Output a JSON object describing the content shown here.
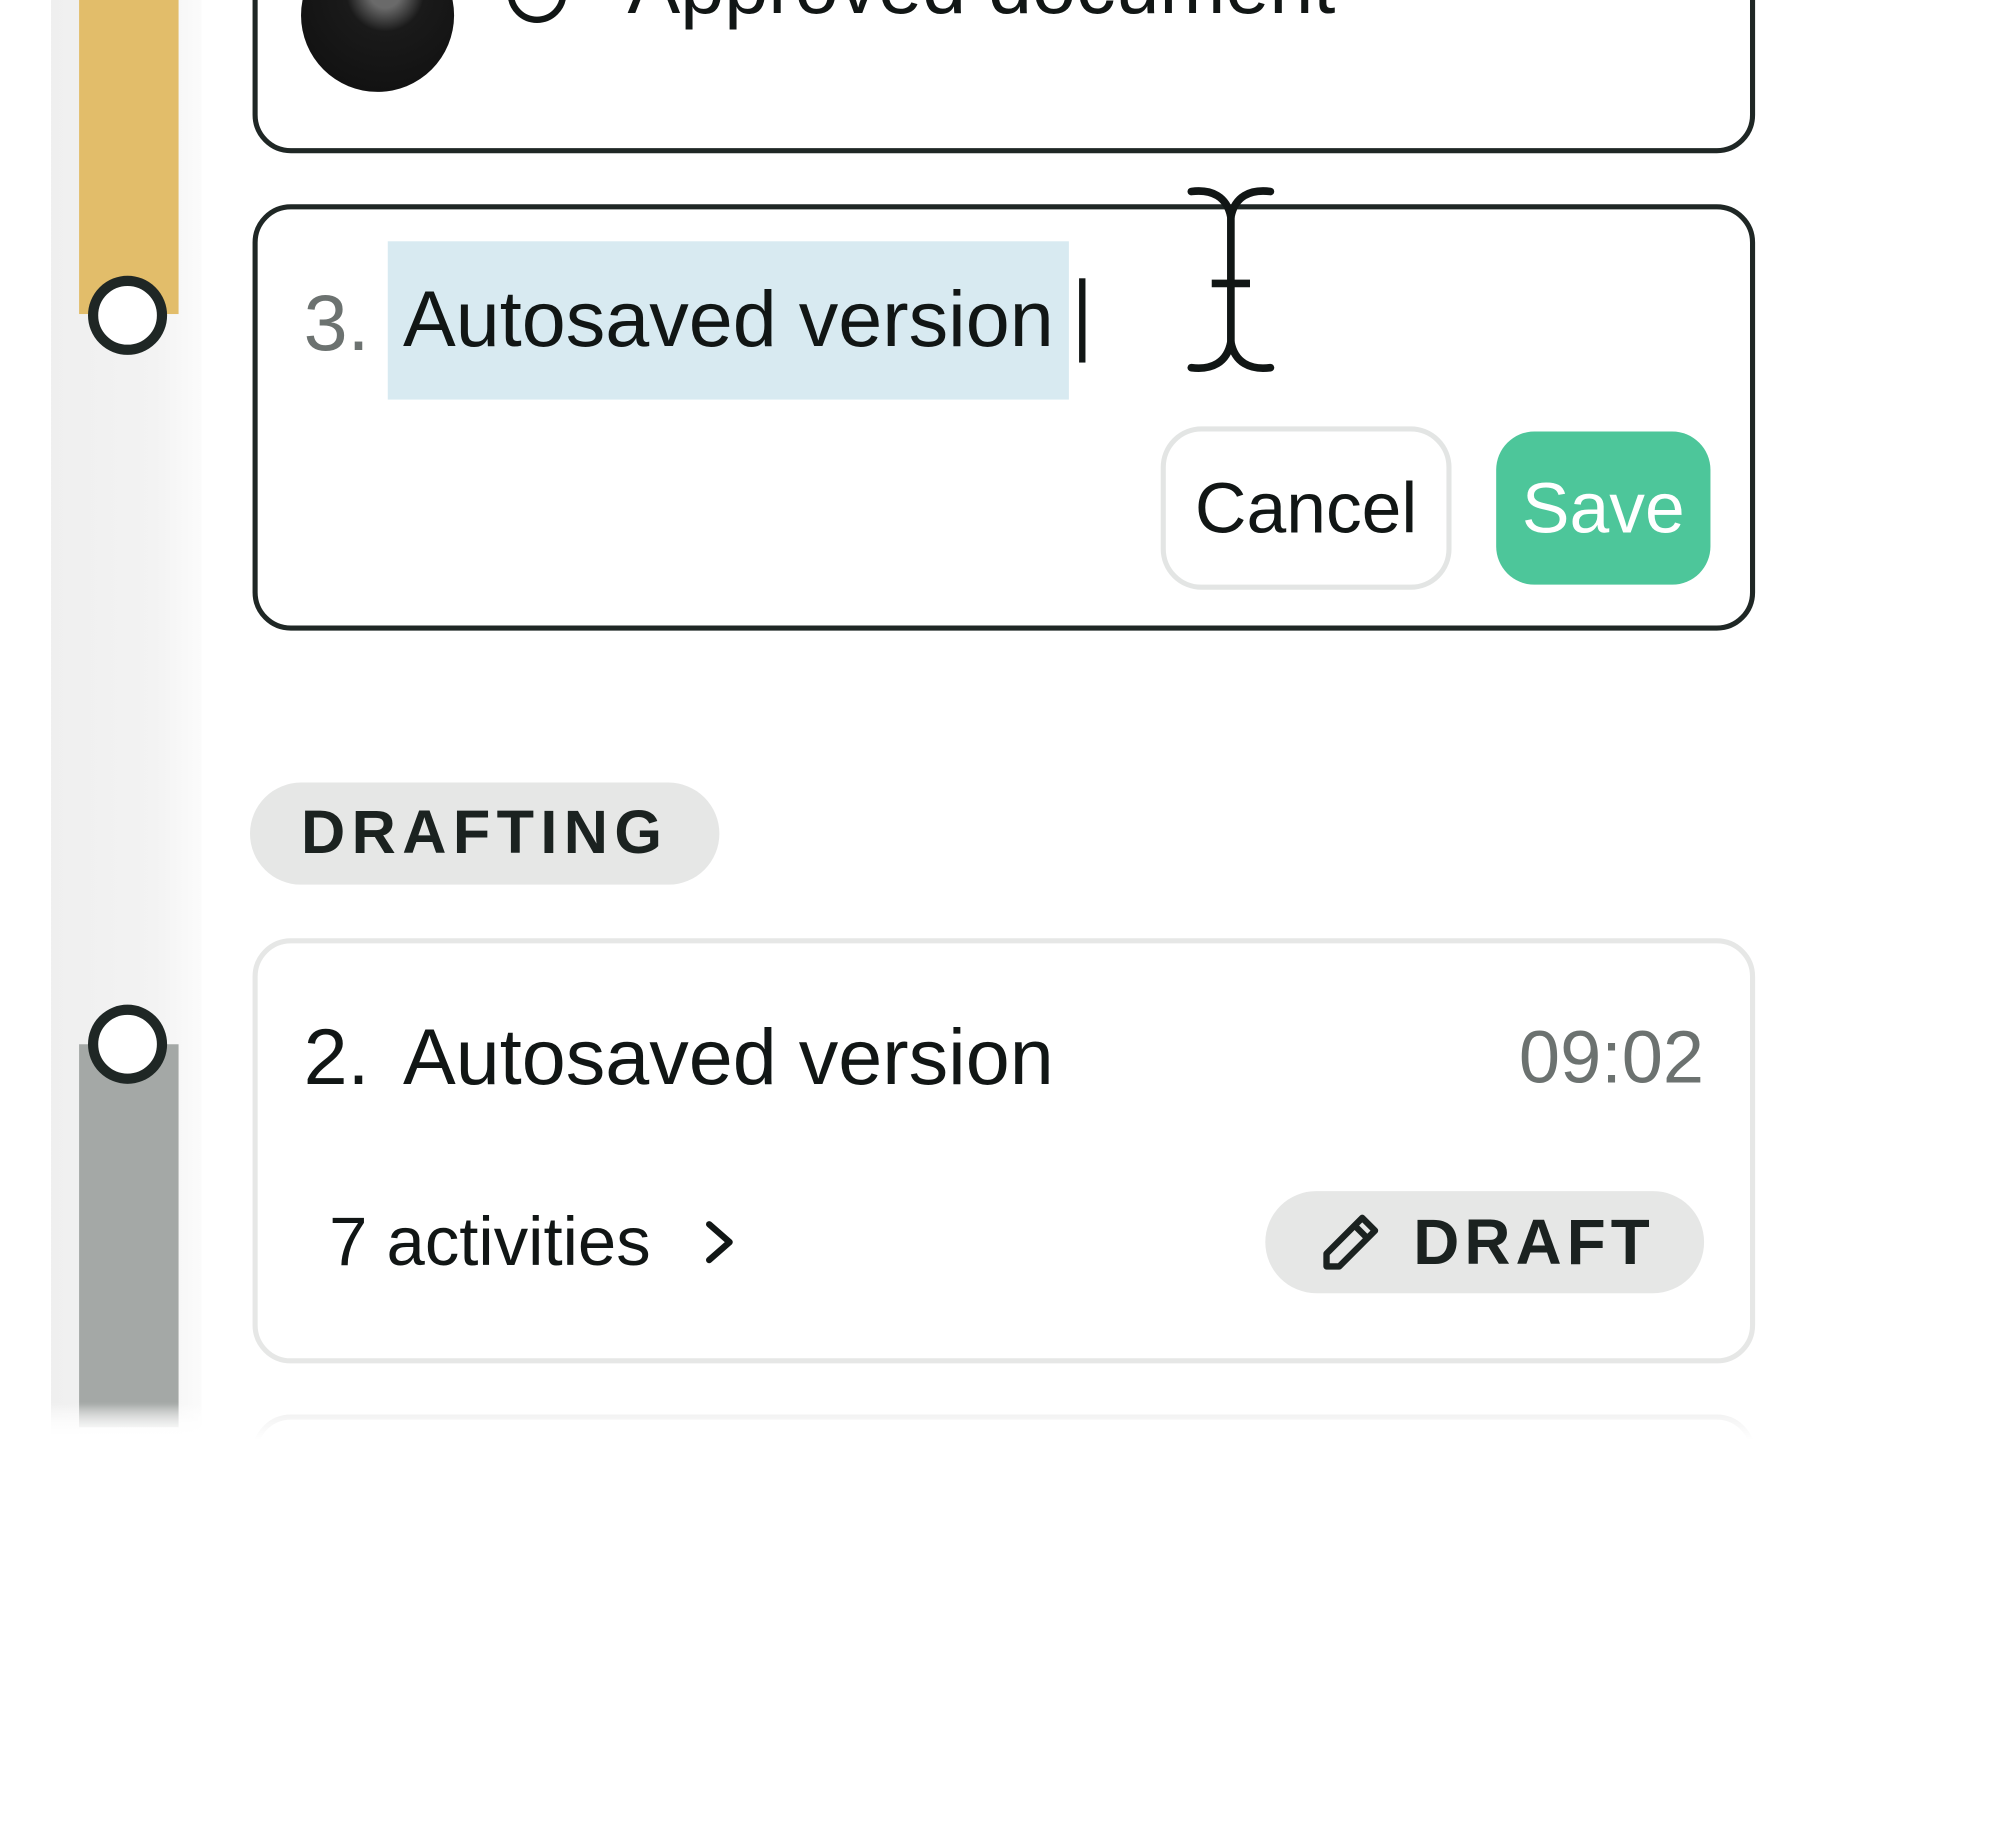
{
  "timeline": {
    "segment_colors": {
      "approved": "#e2bd6a",
      "drafting": "#a4a8a6"
    }
  },
  "approved_card": {
    "title": "Approved document",
    "avatar": "user-avatar-photo",
    "status_icon": "check-circle-icon"
  },
  "edit_card": {
    "number": "3.",
    "name_value": "Autosaved version",
    "cancel_label": "Cancel",
    "save_label": "Save",
    "save_color": "#4dc69a",
    "cursor_icon": "text-cursor-icon"
  },
  "sections": {
    "drafting_label": "DRAFTING"
  },
  "version_card_2": {
    "number": "2.",
    "title": "Autosaved version",
    "time": "09:02",
    "activities_label": "7 activities",
    "chevron_icon": "chevron-right-icon",
    "badge_icon": "pencil-icon",
    "badge_label": "DRAFT"
  }
}
